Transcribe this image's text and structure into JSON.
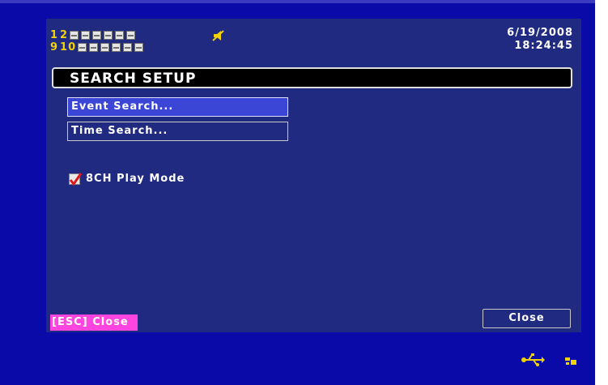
{
  "channels": {
    "row1": {
      "numbers": [
        "1",
        "2"
      ],
      "box_count": 6
    },
    "row2": {
      "numbers": [
        "9",
        "10"
      ],
      "box_count": 6
    },
    "status_icon": "speaker-icon"
  },
  "datetime": {
    "date": "6/19/2008",
    "time": "18:24:45"
  },
  "title": "SEARCH SETUP",
  "menu": [
    {
      "label": "Event Search...",
      "selected": true
    },
    {
      "label": "Time Search...",
      "selected": false
    }
  ],
  "option": {
    "label": "8CH Play Mode",
    "checked": true
  },
  "footer": {
    "esc_hint": "[ESC] Close",
    "close_label": "Close"
  },
  "tray_icons": [
    "usb-icon",
    "drive-icon"
  ],
  "colors": {
    "screen_bg": "#0a0aa8",
    "panel_bg": "#1f2a80",
    "selected": "#3b46d6",
    "hint": "#ff44e0",
    "channel": "#f2d200"
  }
}
